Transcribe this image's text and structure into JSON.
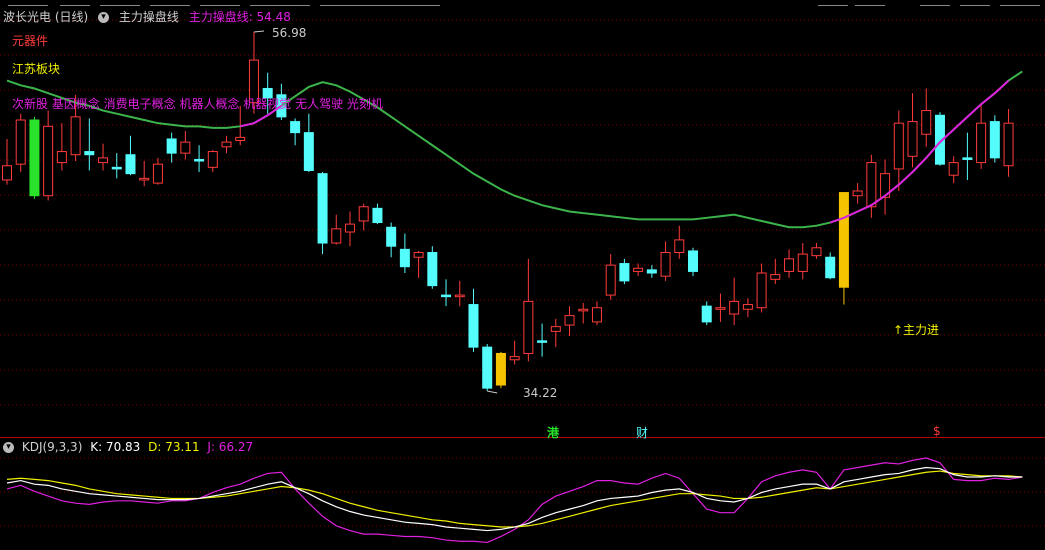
{
  "header": {
    "stock_name": "波长光电 (日线)",
    "indicator_name": "主力操盘线",
    "indicator_value_label": "主力操盘线: 54.48"
  },
  "tags": {
    "industry": "元器件",
    "region": "江苏板块",
    "concepts": "次新股 基因概念 消费电子概念 机器人概念 机器视觉 无人驾驶 光刻机"
  },
  "annotations": {
    "high_price": "56.98",
    "low_price": "34.22",
    "signal": "↑主力进"
  },
  "markers": {
    "m1": "港",
    "m2": "财",
    "m3": "$"
  },
  "kdj": {
    "title": "KDJ(9,3,3)",
    "k_label": "K: 70.83",
    "d_label": "D: 73.11",
    "j_label": "J: 66.27"
  },
  "colors": {
    "up": "#ff3b3b",
    "down": "#54fcfc",
    "yellow_candle": "#f5c400",
    "green_candle": "#29e32b",
    "ma_green": "#3cb44b",
    "ma_magenta": "#e020e0",
    "kdj_k": "#ffffff",
    "kdj_d": "#f0f000",
    "kdj_j": "#e020e0",
    "grid": "#7a0000"
  },
  "chart_data": {
    "type": "candlestick",
    "price_annotations": {
      "high": 56.98,
      "low": 34.22
    },
    "candles": [
      {
        "o": 47.6,
        "c": 48.5,
        "h": 50.2,
        "l": 47.3,
        "t": "up"
      },
      {
        "o": 48.6,
        "c": 51.4,
        "h": 51.8,
        "l": 48.1,
        "t": "up"
      },
      {
        "o": 51.4,
        "c": 46.6,
        "h": 51.6,
        "l": 46.4,
        "t": "green"
      },
      {
        "o": 46.6,
        "c": 51.0,
        "h": 52.0,
        "l": 46.3,
        "t": "up"
      },
      {
        "o": 48.7,
        "c": 49.4,
        "h": 51.2,
        "l": 48.2,
        "t": "up"
      },
      {
        "o": 49.2,
        "c": 51.6,
        "h": 53.0,
        "l": 48.8,
        "t": "up"
      },
      {
        "o": 49.4,
        "c": 49.2,
        "h": 51.5,
        "l": 48.2,
        "t": "down"
      },
      {
        "o": 48.7,
        "c": 49.0,
        "h": 49.9,
        "l": 48.2,
        "t": "up"
      },
      {
        "o": 48.4,
        "c": 48.3,
        "h": 49.3,
        "l": 47.7,
        "t": "down"
      },
      {
        "o": 49.2,
        "c": 48.0,
        "h": 50.4,
        "l": 47.9,
        "t": "down"
      },
      {
        "o": 47.6,
        "c": 47.7,
        "h": 48.8,
        "l": 47.2,
        "t": "up"
      },
      {
        "o": 47.4,
        "c": 48.6,
        "h": 49.0,
        "l": 47.3,
        "t": "up"
      },
      {
        "o": 50.2,
        "c": 49.3,
        "h": 50.6,
        "l": 48.7,
        "t": "down"
      },
      {
        "o": 49.3,
        "c": 50.0,
        "h": 50.7,
        "l": 48.9,
        "t": "up"
      },
      {
        "o": 48.9,
        "c": 48.8,
        "h": 49.8,
        "l": 48.1,
        "t": "down"
      },
      {
        "o": 48.4,
        "c": 49.4,
        "h": 49.5,
        "l": 48.1,
        "t": "up"
      },
      {
        "o": 49.7,
        "c": 50.0,
        "h": 50.4,
        "l": 49.3,
        "t": "up"
      },
      {
        "o": 50.1,
        "c": 50.3,
        "h": 52.3,
        "l": 49.8,
        "t": "up"
      },
      {
        "o": 52.5,
        "c": 55.2,
        "h": 56.98,
        "l": 51.8,
        "t": "up"
      },
      {
        "o": 53.4,
        "c": 52.8,
        "h": 54.4,
        "l": 51.8,
        "t": "down"
      },
      {
        "o": 53.0,
        "c": 51.6,
        "h": 53.7,
        "l": 51.4,
        "t": "down"
      },
      {
        "o": 51.3,
        "c": 50.6,
        "h": 51.5,
        "l": 49.8,
        "t": "down"
      },
      {
        "o": 50.6,
        "c": 48.2,
        "h": 51.8,
        "l": 48.1,
        "t": "down"
      },
      {
        "o": 48.0,
        "c": 43.6,
        "h": 48.1,
        "l": 42.9,
        "t": "down"
      },
      {
        "o": 43.6,
        "c": 44.5,
        "h": 45.4,
        "l": 43.5,
        "t": "up"
      },
      {
        "o": 44.3,
        "c": 44.8,
        "h": 45.6,
        "l": 43.4,
        "t": "up"
      },
      {
        "o": 45.0,
        "c": 45.9,
        "h": 46.1,
        "l": 44.4,
        "t": "up"
      },
      {
        "o": 45.8,
        "c": 44.9,
        "h": 46.1,
        "l": 44.8,
        "t": "down"
      },
      {
        "o": 44.6,
        "c": 43.4,
        "h": 44.9,
        "l": 42.7,
        "t": "down"
      },
      {
        "o": 43.2,
        "c": 42.1,
        "h": 44.2,
        "l": 41.7,
        "t": "down"
      },
      {
        "o": 42.7,
        "c": 43.0,
        "h": 43.1,
        "l": 41.4,
        "t": "up"
      },
      {
        "o": 43.0,
        "c": 40.9,
        "h": 43.4,
        "l": 40.7,
        "t": "down"
      },
      {
        "o": 40.3,
        "c": 40.2,
        "h": 41.3,
        "l": 39.6,
        "t": "down"
      },
      {
        "o": 40.2,
        "c": 40.3,
        "h": 41.2,
        "l": 39.6,
        "t": "up"
      },
      {
        "o": 39.7,
        "c": 37.0,
        "h": 40.7,
        "l": 36.7,
        "t": "down"
      },
      {
        "o": 37.0,
        "c": 34.4,
        "h": 37.2,
        "l": 34.22,
        "t": "down"
      },
      {
        "o": 34.6,
        "c": 36.6,
        "h": 36.7,
        "l": 34.4,
        "t": "yellow"
      },
      {
        "o": 36.2,
        "c": 36.4,
        "h": 37.4,
        "l": 35.9,
        "t": "up"
      },
      {
        "o": 36.6,
        "c": 39.9,
        "h": 42.6,
        "l": 36.1,
        "t": "up"
      },
      {
        "o": 37.4,
        "c": 37.4,
        "h": 38.5,
        "l": 36.4,
        "t": "down"
      },
      {
        "o": 38.0,
        "c": 38.3,
        "h": 38.8,
        "l": 37.0,
        "t": "up"
      },
      {
        "o": 38.4,
        "c": 39.0,
        "h": 39.6,
        "l": 37.7,
        "t": "up"
      },
      {
        "o": 39.4,
        "c": 39.3,
        "h": 39.8,
        "l": 38.5,
        "t": "up"
      },
      {
        "o": 38.6,
        "c": 39.5,
        "h": 39.9,
        "l": 38.4,
        "t": "up"
      },
      {
        "o": 40.3,
        "c": 42.2,
        "h": 42.9,
        "l": 40.0,
        "t": "up"
      },
      {
        "o": 42.3,
        "c": 41.2,
        "h": 42.6,
        "l": 41.0,
        "t": "down"
      },
      {
        "o": 41.8,
        "c": 42.0,
        "h": 42.3,
        "l": 41.5,
        "t": "up"
      },
      {
        "o": 41.9,
        "c": 41.7,
        "h": 42.2,
        "l": 41.4,
        "t": "down"
      },
      {
        "o": 41.5,
        "c": 43.0,
        "h": 43.7,
        "l": 41.2,
        "t": "up"
      },
      {
        "o": 43.0,
        "c": 43.8,
        "h": 44.7,
        "l": 42.6,
        "t": "up"
      },
      {
        "o": 43.1,
        "c": 41.8,
        "h": 43.3,
        "l": 41.5,
        "t": "down"
      },
      {
        "o": 39.6,
        "c": 38.6,
        "h": 39.9,
        "l": 38.4,
        "t": "down"
      },
      {
        "o": 39.4,
        "c": 39.5,
        "h": 40.4,
        "l": 38.6,
        "t": "up"
      },
      {
        "o": 39.1,
        "c": 39.9,
        "h": 41.4,
        "l": 38.4,
        "t": "up"
      },
      {
        "o": 39.4,
        "c": 39.7,
        "h": 40.1,
        "l": 38.9,
        "t": "up"
      },
      {
        "o": 39.5,
        "c": 41.7,
        "h": 42.3,
        "l": 39.2,
        "t": "up"
      },
      {
        "o": 41.3,
        "c": 41.6,
        "h": 42.6,
        "l": 41.0,
        "t": "up"
      },
      {
        "o": 41.8,
        "c": 42.6,
        "h": 43.2,
        "l": 41.4,
        "t": "up"
      },
      {
        "o": 41.8,
        "c": 42.9,
        "h": 43.6,
        "l": 41.3,
        "t": "up"
      },
      {
        "o": 42.8,
        "c": 43.3,
        "h": 43.6,
        "l": 42.6,
        "t": "up"
      },
      {
        "o": 42.7,
        "c": 41.4,
        "h": 43.0,
        "l": 41.3,
        "t": "down"
      },
      {
        "o": 40.8,
        "c": 46.8,
        "h": 46.8,
        "l": 39.7,
        "t": "yellow"
      },
      {
        "o": 46.6,
        "c": 46.9,
        "h": 47.4,
        "l": 46.1,
        "t": "up"
      },
      {
        "o": 45.9,
        "c": 48.7,
        "h": 49.2,
        "l": 45.2,
        "t": "up"
      },
      {
        "o": 46.5,
        "c": 48.0,
        "h": 48.9,
        "l": 45.4,
        "t": "up"
      },
      {
        "o": 48.3,
        "c": 51.2,
        "h": 52.0,
        "l": 46.9,
        "t": "up"
      },
      {
        "o": 49.1,
        "c": 51.3,
        "h": 53.1,
        "l": 48.4,
        "t": "up"
      },
      {
        "o": 50.5,
        "c": 52.0,
        "h": 53.4,
        "l": 49.7,
        "t": "up"
      },
      {
        "o": 51.7,
        "c": 48.6,
        "h": 51.9,
        "l": 48.5,
        "t": "down"
      },
      {
        "o": 48.7,
        "c": 47.9,
        "h": 49.1,
        "l": 47.4,
        "t": "up"
      },
      {
        "o": 48.9,
        "c": 49.0,
        "h": 50.6,
        "l": 47.6,
        "t": "down"
      },
      {
        "o": 48.7,
        "c": 51.2,
        "h": 52.4,
        "l": 48.3,
        "t": "up"
      },
      {
        "o": 51.3,
        "c": 49.0,
        "h": 51.7,
        "l": 48.7,
        "t": "down"
      },
      {
        "o": 48.5,
        "c": 51.2,
        "h": 52.1,
        "l": 47.8,
        "t": "up"
      }
    ],
    "ma_line": [
      53.9,
      53.6,
      53.4,
      53.1,
      52.8,
      52.5,
      52.3,
      52.0,
      51.8,
      51.6,
      51.4,
      51.2,
      51.1,
      51.0,
      51.0,
      50.9,
      50.9,
      51.0,
      51.2,
      51.7,
      52.3,
      52.9,
      53.5,
      53.8,
      53.6,
      53.2,
      52.7,
      52.2,
      51.6,
      51.0,
      50.4,
      49.8,
      49.2,
      48.6,
      48.0,
      47.5,
      47.0,
      46.6,
      46.3,
      46.0,
      45.8,
      45.6,
      45.5,
      45.4,
      45.3,
      45.2,
      45.1,
      45.1,
      45.1,
      45.1,
      45.1,
      45.2,
      45.3,
      45.4,
      45.2,
      45.0,
      44.8,
      44.6,
      44.6,
      44.7,
      44.9,
      45.2,
      45.6,
      46.0,
      46.6,
      47.3,
      48.1,
      49.0,
      50.0,
      50.8,
      51.6,
      52.4,
      53.1,
      53.9,
      54.48
    ],
    "magenta_segments": [
      [
        17,
        20
      ],
      [
        60,
        73
      ]
    ],
    "kdj": {
      "K": [
        53,
        55,
        52,
        51,
        48,
        46,
        44,
        43,
        42,
        41,
        40,
        39,
        39,
        39,
        40,
        42,
        44,
        46,
        49,
        52,
        54,
        49,
        44,
        38,
        33,
        29,
        26,
        24,
        22,
        20,
        19,
        18,
        16,
        15,
        14,
        13,
        14,
        16,
        19,
        24,
        28,
        31,
        34,
        38,
        40,
        41,
        42,
        45,
        47,
        48,
        45,
        40,
        38,
        37,
        40,
        45,
        48,
        50,
        52,
        52,
        48,
        54,
        56,
        58,
        60,
        61,
        64,
        66,
        65,
        60,
        58,
        58,
        59,
        58,
        58
      ],
      "D": [
        56,
        57,
        56,
        55,
        53,
        51,
        48,
        46,
        44,
        43,
        42,
        41,
        40,
        40,
        40,
        41,
        42,
        44,
        46,
        48,
        50,
        49,
        47,
        44,
        40,
        36,
        33,
        30,
        28,
        26,
        24,
        22,
        21,
        19,
        18,
        17,
        16,
        16,
        17,
        19,
        22,
        25,
        28,
        31,
        34,
        36,
        38,
        40,
        42,
        44,
        44,
        43,
        42,
        40,
        40,
        41,
        43,
        45,
        47,
        49,
        48,
        50,
        52,
        54,
        56,
        58,
        60,
        62,
        63,
        61,
        60,
        59,
        59,
        59,
        58
      ],
      "J": [
        48,
        51,
        46,
        42,
        38,
        36,
        35,
        37,
        38,
        38,
        37,
        36,
        38,
        38,
        40,
        45,
        49,
        52,
        57,
        61,
        62,
        48,
        36,
        25,
        17,
        13,
        10,
        10,
        9,
        8,
        8,
        7,
        5,
        4,
        4,
        3,
        8,
        14,
        22,
        35,
        42,
        46,
        50,
        55,
        55,
        53,
        52,
        57,
        61,
        57,
        44,
        31,
        28,
        28,
        40,
        54,
        59,
        62,
        64,
        62,
        48,
        64,
        66,
        68,
        70,
        69,
        72,
        74,
        70,
        56,
        55,
        55,
        57,
        56,
        58
      ]
    }
  }
}
